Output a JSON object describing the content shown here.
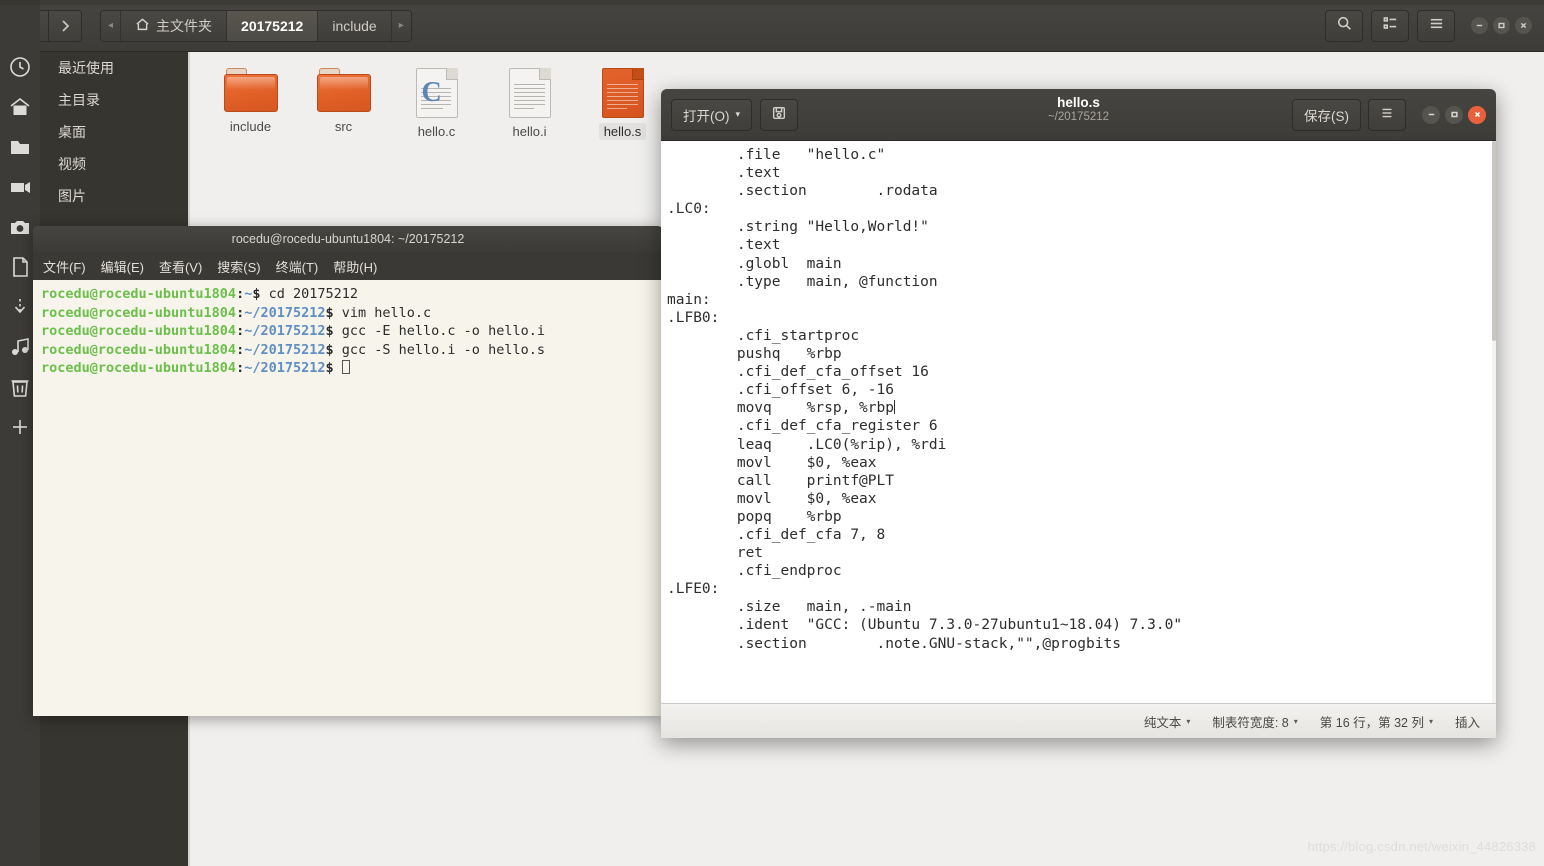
{
  "launcher": {
    "items": [
      {
        "name": "clock-icon",
        "label": "Recent"
      },
      {
        "name": "home-icon",
        "label": "Home"
      },
      {
        "name": "folder-icon",
        "label": "Files"
      },
      {
        "name": "video-icon",
        "label": "Videos"
      },
      {
        "name": "camera-icon",
        "label": "Photos"
      },
      {
        "name": "document-icon",
        "label": "Documents"
      },
      {
        "name": "download-icon",
        "label": "Downloads"
      },
      {
        "name": "music-icon",
        "label": "Music"
      },
      {
        "name": "trash-icon",
        "label": "Trash"
      },
      {
        "name": "plus-icon",
        "label": "Add"
      }
    ]
  },
  "file_manager": {
    "nav": {
      "back": "‹",
      "forward": "›"
    },
    "breadcrumb": {
      "left_arrow": "◂",
      "right_arrow": "▸",
      "items": [
        {
          "label": "主文件夹",
          "icon": "home-icon",
          "active": false
        },
        {
          "label": "20175212",
          "icon": "",
          "active": true
        },
        {
          "label": "include",
          "icon": "",
          "active": false
        }
      ]
    },
    "toolbar": {
      "search_icon": "search-icon",
      "view_icon": "list-view-icon",
      "menu_icon": "hamburger-menu-icon",
      "minimize": "−",
      "maximize": "▭",
      "close": "×"
    },
    "sidebar": {
      "items": [
        {
          "label": "最近使用"
        },
        {
          "label": "主目录"
        },
        {
          "label": "桌面"
        },
        {
          "label": "视频"
        },
        {
          "label": "图片"
        }
      ]
    },
    "files": [
      {
        "name": "include",
        "type": "folder",
        "selected": false
      },
      {
        "name": "src",
        "type": "folder",
        "selected": false
      },
      {
        "name": "hello.c",
        "type": "c-source",
        "selected": false
      },
      {
        "name": "hello.i",
        "type": "text",
        "selected": false
      },
      {
        "name": "hello.s",
        "type": "assembly",
        "selected": true
      }
    ]
  },
  "terminal": {
    "title": "rocedu@rocedu-ubuntu1804: ~/20175212",
    "menu": [
      "文件(F)",
      "编辑(E)",
      "查看(V)",
      "搜索(S)",
      "终端(T)",
      "帮助(H)"
    ],
    "lines": [
      {
        "user": "rocedu@rocedu-ubuntu1804",
        "sep": ":",
        "path": "~",
        "dollar": "$",
        "cmd": " cd 20175212"
      },
      {
        "user": "rocedu@rocedu-ubuntu1804",
        "sep": ":",
        "path": "~/20175212",
        "dollar": "$",
        "cmd": " vim hello.c"
      },
      {
        "user": "rocedu@rocedu-ubuntu1804",
        "sep": ":",
        "path": "~/20175212",
        "dollar": "$",
        "cmd": " gcc -E hello.c -o hello.i"
      },
      {
        "user": "rocedu@rocedu-ubuntu1804",
        "sep": ":",
        "path": "~/20175212",
        "dollar": "$",
        "cmd": " gcc -S hello.i -o hello.s"
      },
      {
        "user": "rocedu@rocedu-ubuntu1804",
        "sep": ":",
        "path": "~/20175212",
        "dollar": "$",
        "cmd": " ",
        "cursor": true
      }
    ]
  },
  "gedit": {
    "open_button": "打开(O)",
    "open_caret": "▾",
    "save_as_icon": "save-as-icon",
    "title": "hello.s",
    "subtitle": "~/20175212",
    "save_button": "保存(S)",
    "menu_icon": "hamburger-menu-icon",
    "window_controls": {
      "minimize": "−",
      "maximize": "▭",
      "close": "×"
    },
    "code_lines": [
      "        .file   \"hello.c\"",
      "        .text",
      "        .section        .rodata",
      ".LC0:",
      "        .string \"Hello,World!\"",
      "        .text",
      "        .globl  main",
      "        .type   main, @function",
      "main:",
      ".LFB0:",
      "        .cfi_startproc",
      "        pushq   %rbp",
      "        .cfi_def_cfa_offset 16",
      "        .cfi_offset 6, -16",
      "        movq    %rsp, %rbp",
      "        .cfi_def_cfa_register 6",
      "        leaq    .LC0(%rip), %rdi",
      "        movl    $0, %eax",
      "        call    printf@PLT",
      "        movl    $0, %eax",
      "        popq    %rbp",
      "        .cfi_def_cfa 7, 8",
      "        ret",
      "        .cfi_endproc",
      ".LFE0:",
      "        .size   main, .-main",
      "        .ident  \"GCC: (Ubuntu 7.3.0-27ubuntu1~18.04) 7.3.0\"",
      "        .section        .note.GNU-stack,\"\",@progbits"
    ],
    "caret_line_index": 15,
    "status": {
      "language": "纯文本",
      "tab_width_label": "制表符宽度: 8",
      "position": "第 16 行，第 32 列",
      "mode": "插入",
      "dropdown_caret": "▾"
    }
  },
  "watermark": "https://blog.csdn.net/weixin_44826338",
  "colors": {
    "chrome_dark": "#3e3c38",
    "folder_orange": "#e2622a",
    "terminal_green": "#6bbf4a",
    "terminal_blue": "#5f8ec4",
    "terminal_bg": "#f7f5eb",
    "close_red": "#e8603c",
    "selection_gray": "#e3e1df"
  }
}
